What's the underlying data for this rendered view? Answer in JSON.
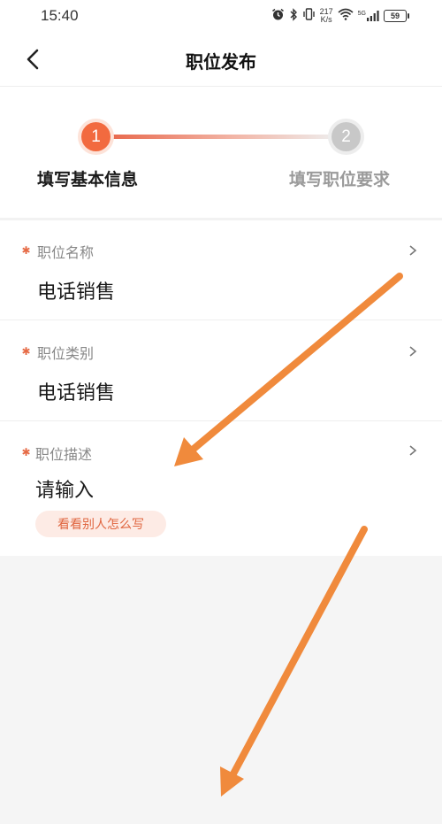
{
  "status_bar": {
    "time": "15:40",
    "net_speed_value": "217",
    "net_speed_unit": "K/s",
    "signal_type": "5G",
    "battery_level": "59"
  },
  "header": {
    "title": "职位发布"
  },
  "stepper": {
    "step1": {
      "number": "1",
      "label": "填写基本信息"
    },
    "step2": {
      "number": "2",
      "label": "填写职位要求"
    }
  },
  "form": {
    "job_name": {
      "label": "职位名称",
      "value": "电话销售"
    },
    "job_category": {
      "label": "职位类别",
      "value": "电话销售"
    },
    "job_description": {
      "label": "职位描述",
      "placeholder": "请输入",
      "hint_button": "看看别人怎么写"
    }
  },
  "colors": {
    "accent": "#f26a3f",
    "annotation_arrow": "#f08a3c",
    "background": "#f5f5f5"
  }
}
